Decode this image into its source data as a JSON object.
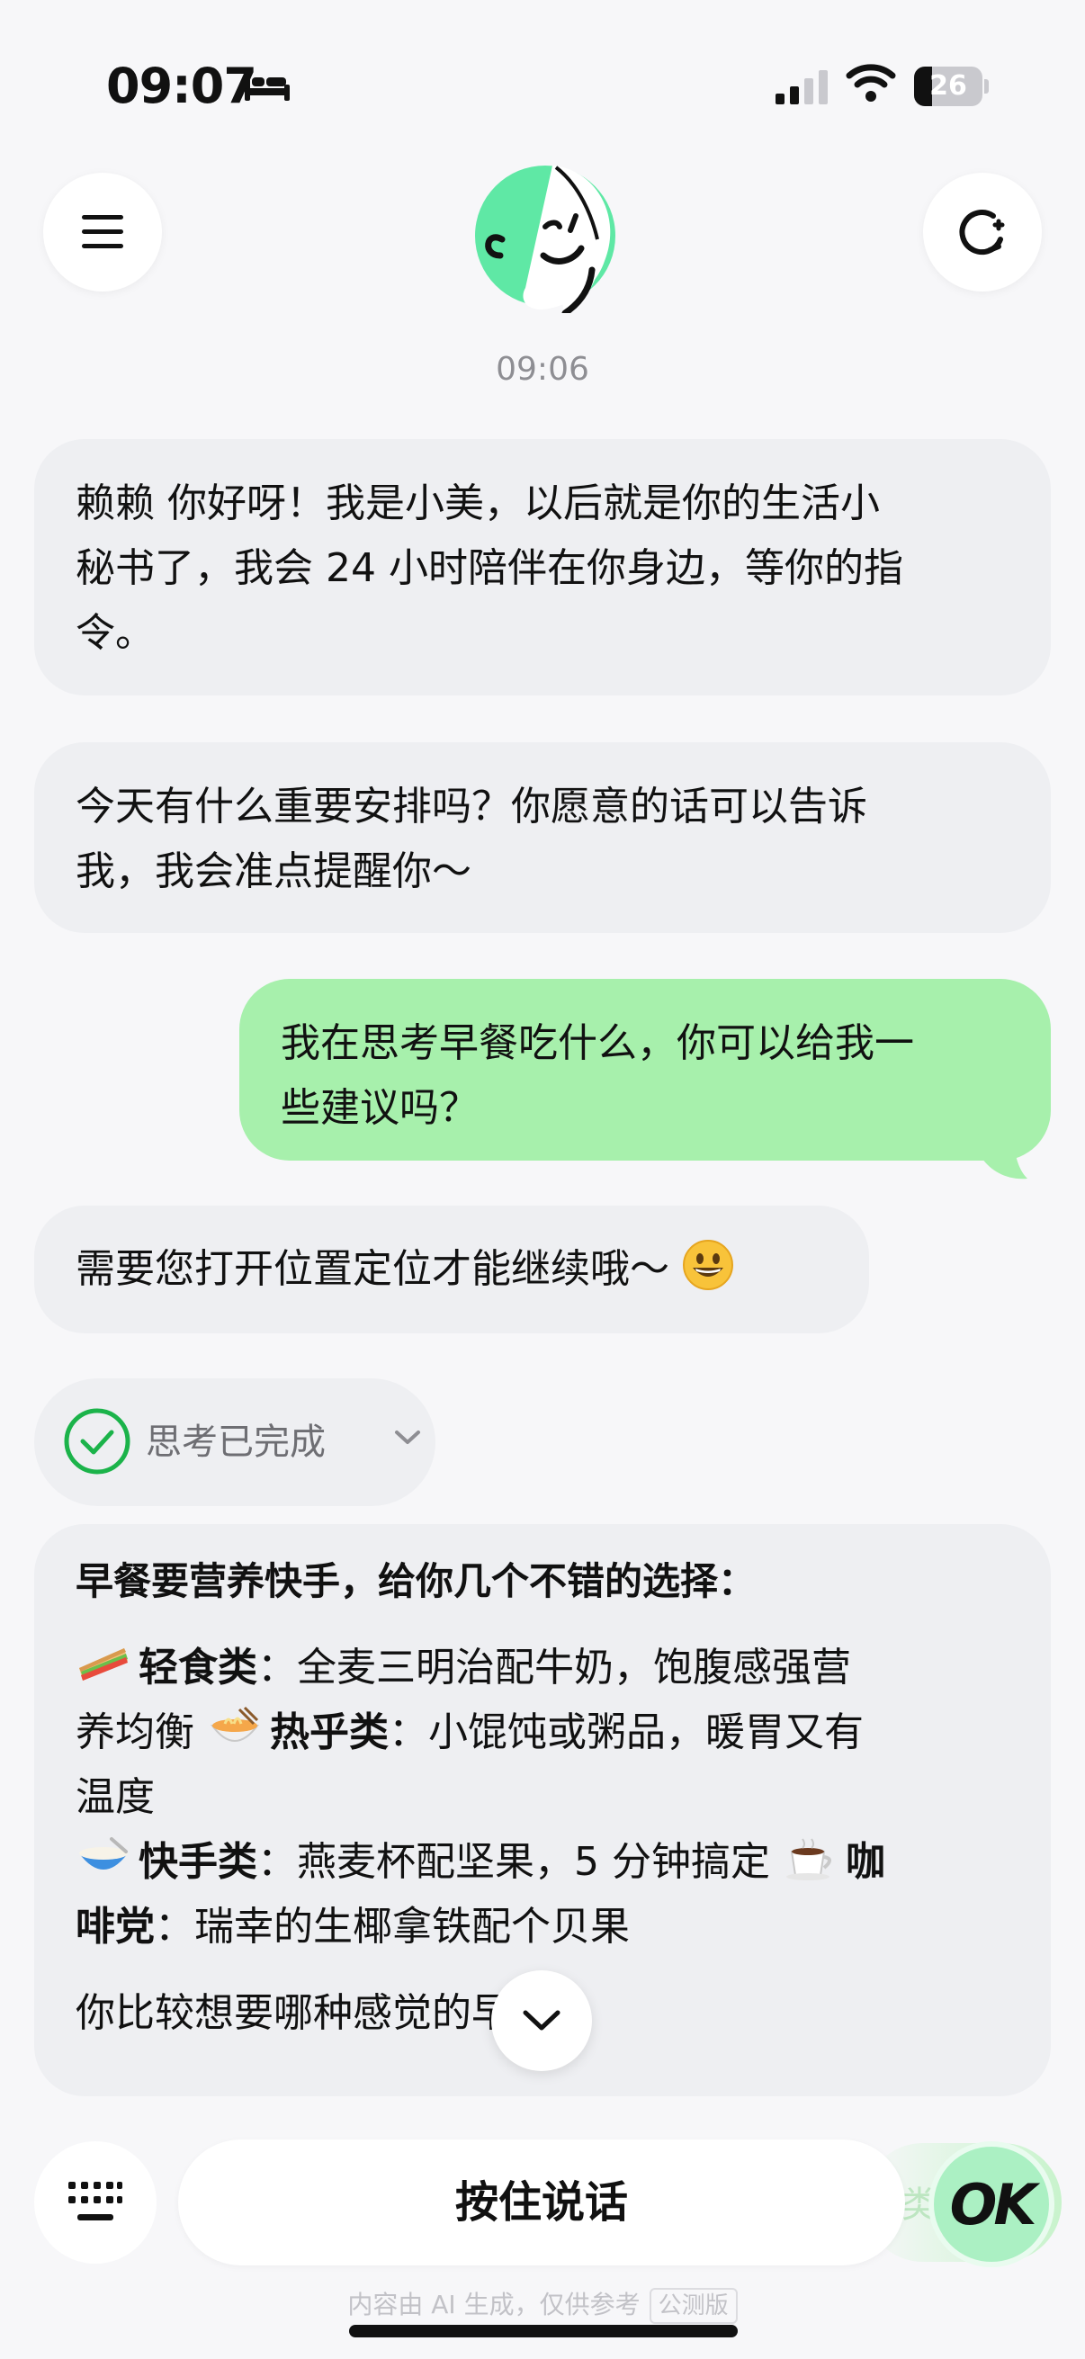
{
  "status_bar": {
    "time": "09:07",
    "battery_level": "26",
    "icons": [
      "bed-icon",
      "cellular-signal-icon",
      "wifi-icon",
      "battery-icon"
    ]
  },
  "header": {
    "menu_icon": "hamburger-menu-icon",
    "new_chat_icon": "refresh-plus-icon",
    "avatar": "assistant-avatar"
  },
  "chat": {
    "timestamp": "09:06",
    "messages": [
      {
        "role": "assistant",
        "lines": [
          "赖赖 你好呀！我是小美，以后就是你的生活小",
          "秘书了，我会 24 小时陪伴在你身边，等你的指",
          "令。"
        ]
      },
      {
        "role": "assistant",
        "lines": [
          "今天有什么重要安排吗？你愿意的话可以告诉",
          "我，我会准点提醒你～"
        ]
      },
      {
        "role": "user",
        "lines": [
          "我在思考早餐吃什么，你可以给我一",
          "些建议吗？"
        ]
      },
      {
        "role": "assistant",
        "text": "需要您打开位置定位才能继续哦～",
        "emoji": "grinning-face-emoji"
      }
    ],
    "thinking": {
      "label": "思考已完成",
      "status_icon": "check-circle-icon"
    },
    "answer": {
      "heading": "早餐要营养快手，给你几个不错的选择：",
      "line1_cat": "轻食类",
      "line1_text": "：全麦三明治配牛奶，饱腹感强营",
      "line2_text": "养均衡 ",
      "line2_cat": "热乎类",
      "line2_rest": "：小馄饨或粥品，暖胃又有",
      "line3_text": "温度",
      "line4_cat": "快手类",
      "line4_text": "：燕麦杯配坚果，5 分钟搞定 ",
      "line4_cat2": "咖",
      "line5_cat": "啡党",
      "line5_text": "：瑞幸的生椰拿铁配个贝果",
      "closing": "你比较想要哪种感觉的早餐?",
      "emojis": [
        "sandwich-emoji",
        "noodle-bowl-emoji",
        "bowl-emoji",
        "coffee-emoji"
      ]
    }
  },
  "input_bar": {
    "keyboard_icon": "keyboard-icon",
    "hold_to_talk": "按住说话",
    "ok_label": "OK",
    "behind_text": "类"
  },
  "footer": {
    "note": "内容由 AI 生成，仅供参考",
    "badge": "公测版"
  },
  "colors": {
    "bot_bubble": "#eeeff2",
    "user_bubble": "#a7f0ac",
    "accent_green": "#1bb34a",
    "avatar_green": "#5fe8a5",
    "background": "#f7f7f9"
  }
}
